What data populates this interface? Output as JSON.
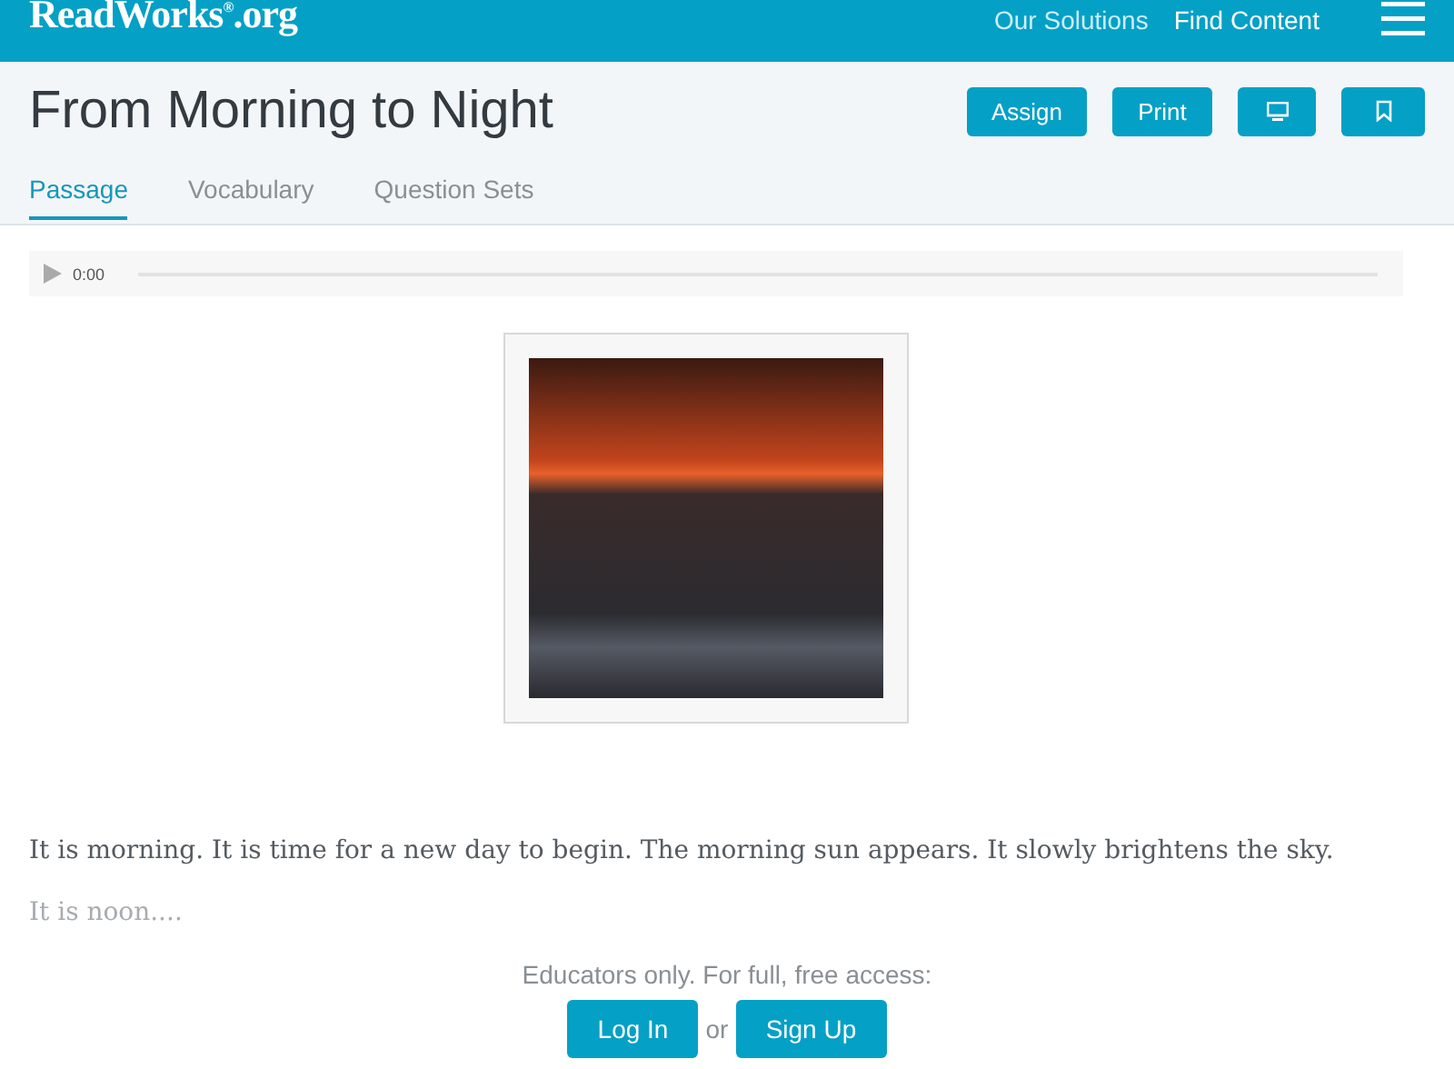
{
  "header": {
    "logo": "ReadWorks$^{®}$.org",
    "nav": [
      "Our Solutions",
      "Find Content"
    ]
  },
  "title": "From Morning to Night",
  "actions": [
    {
      "kind": "text",
      "label": "Assign"
    },
    {
      "kind": "text",
      "label": "Print"
    },
    {
      "kind": "monitor"
    },
    {
      "kind": "bookmark"
    }
  ],
  "tabs": [
    {
      "label": "Passage",
      "selected": true
    },
    {
      "label": "Vocabulary",
      "selected": false
    },
    {
      "label": "Question Sets",
      "selected": false
    }
  ],
  "audio": {
    "time": "0:00"
  },
  "passage": [
    "It is morning. It is time for a new day to begin. The morning sun appears. It slowly brightens the sky.",
    "It is noon...."
  ],
  "access": {
    "prompt": "Educators only. For full, free access:",
    "login": "Log In",
    "or": "or",
    "signup": "Sign Up"
  }
}
